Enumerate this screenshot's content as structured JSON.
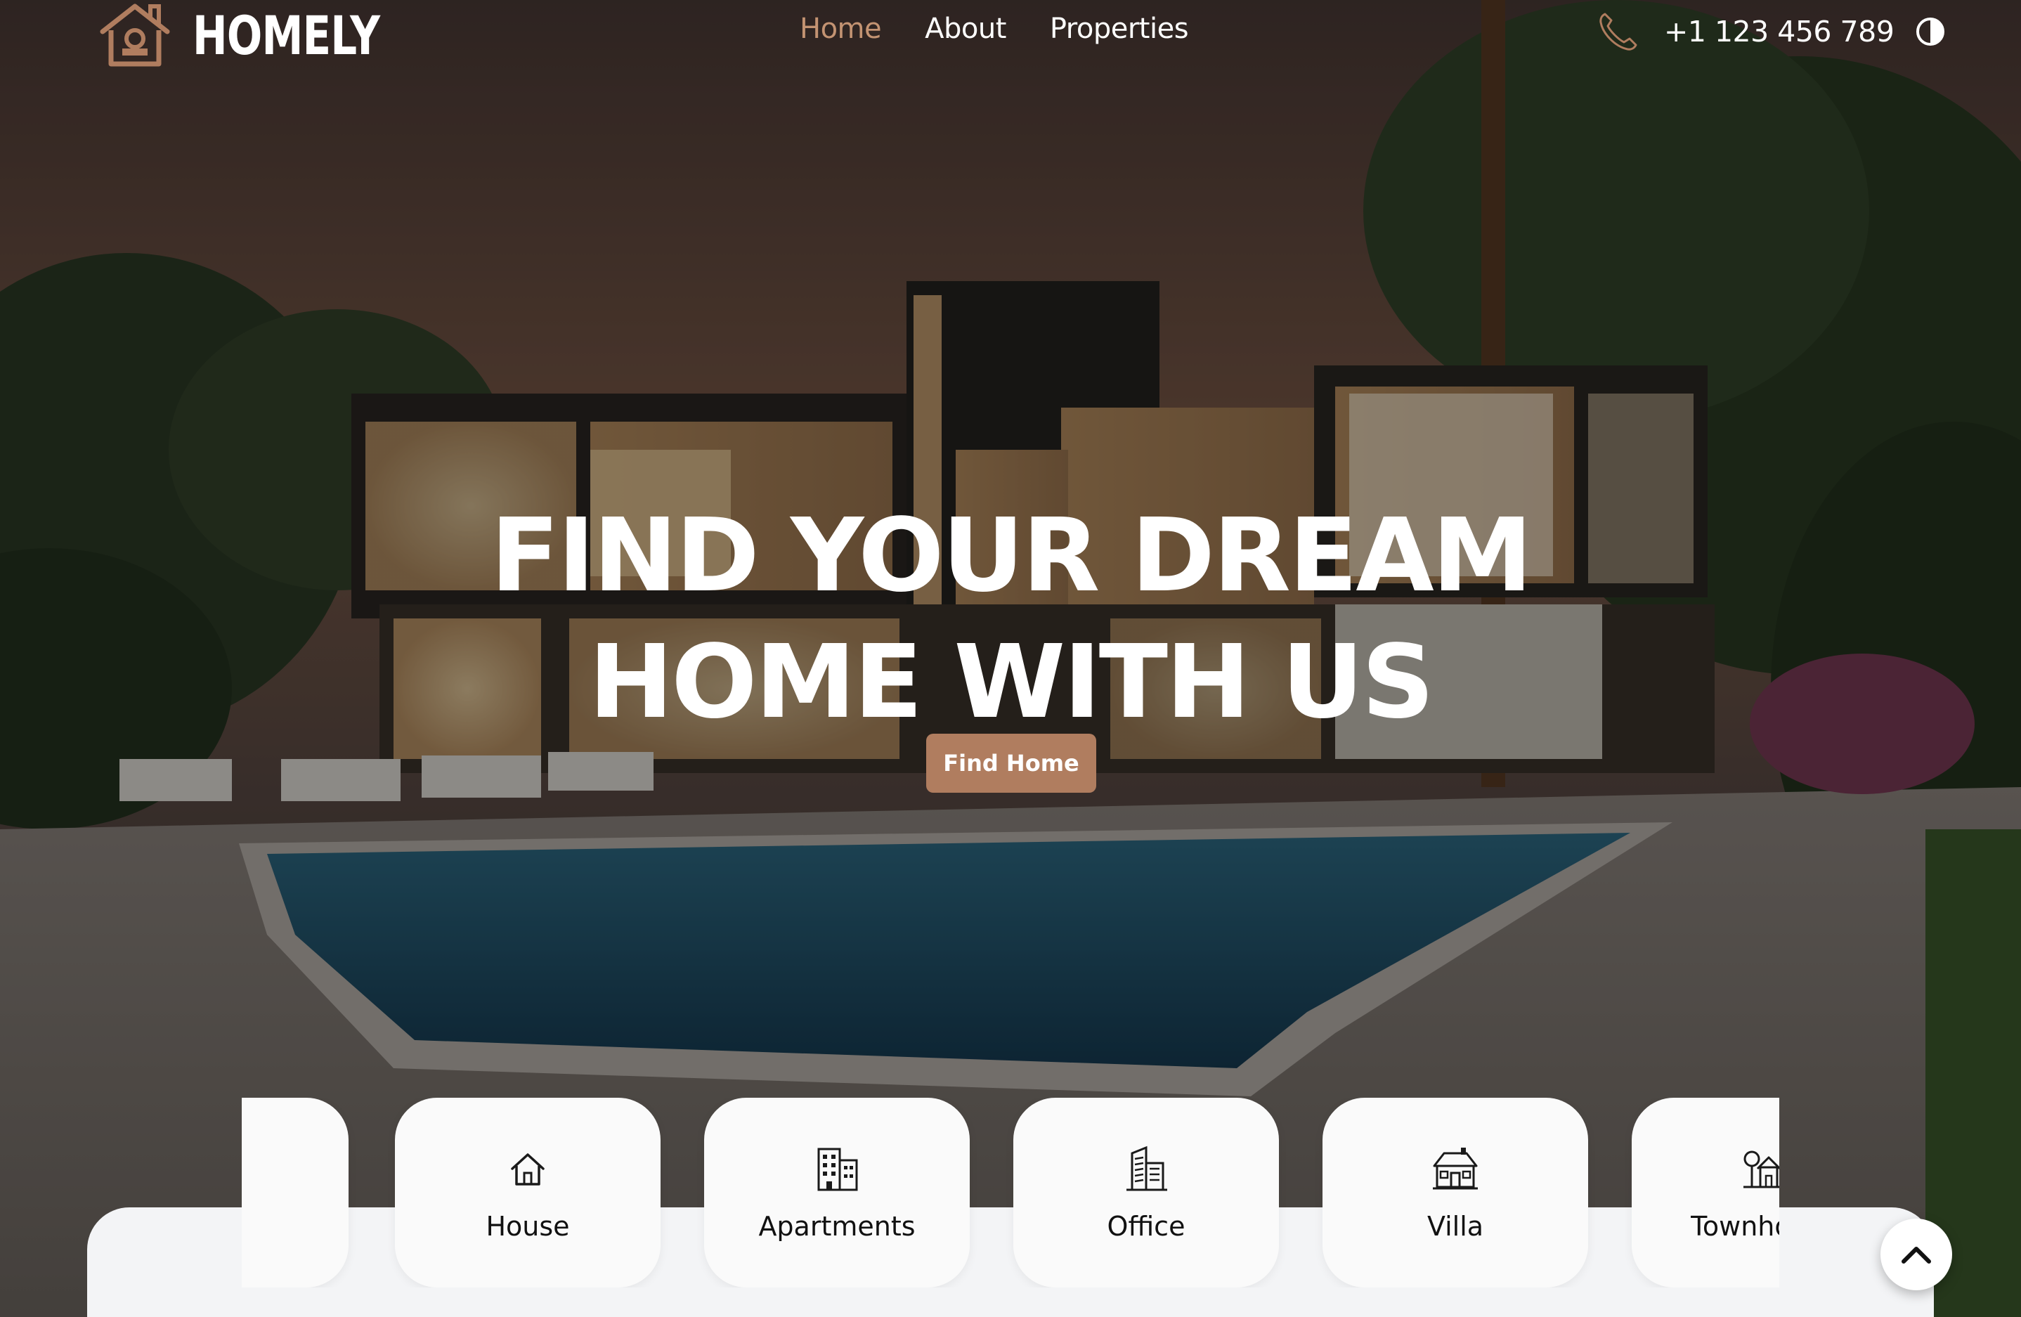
{
  "brand": {
    "name": "HOMELY",
    "accent_color": "#b07d5f",
    "nav_active_color": "#c39372"
  },
  "nav": {
    "items": [
      {
        "label": "Home",
        "active": true
      },
      {
        "label": "About",
        "active": false
      },
      {
        "label": "Properties",
        "active": false
      }
    ]
  },
  "contact": {
    "phone": "+1 123 456 789",
    "phone_icon": "phone-icon",
    "theme_icon": "contrast-icon"
  },
  "hero": {
    "headline_line1": "FIND YOUR DREAM",
    "headline_line2": "HOME WITH US",
    "cta_label": "Find Home"
  },
  "categories": [
    {
      "label": "",
      "icon": ""
    },
    {
      "label": "House",
      "icon": "house-icon"
    },
    {
      "label": "Apartments",
      "icon": "apartment-building-icon"
    },
    {
      "label": "Office",
      "icon": "office-building-icon"
    },
    {
      "label": "Villa",
      "icon": "villa-icon"
    },
    {
      "label": "Townhouse",
      "icon": "townhouse-icon"
    }
  ],
  "scroll_top": {
    "icon": "chevron-up-icon"
  }
}
